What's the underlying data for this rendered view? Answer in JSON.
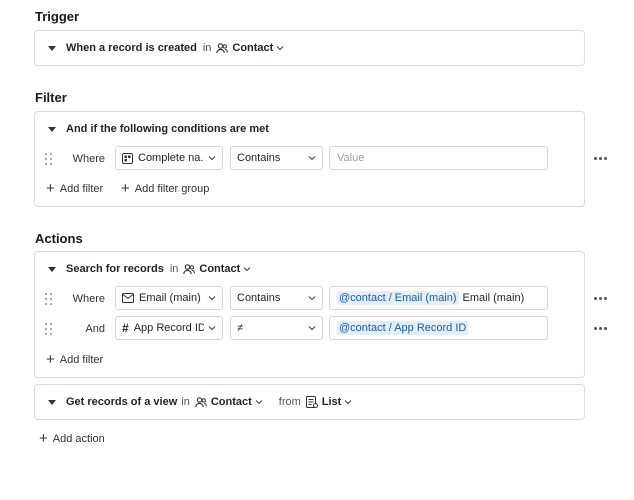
{
  "trigger": {
    "section_title": "Trigger",
    "text": "When a record is created",
    "in_label": "in",
    "entity": "Contact"
  },
  "filter": {
    "section_title": "Filter",
    "header": "And if the following conditions are met",
    "row": {
      "label": "Where",
      "field": "Complete na...",
      "operator": "Contains",
      "value_placeholder": "Value"
    },
    "add_filter": "Add filter",
    "add_filter_group": "Add filter group"
  },
  "actions": {
    "section_title": "Actions",
    "search": {
      "text": "Search for records",
      "in_label": "in",
      "entity": "Contact",
      "rows": [
        {
          "label": "Where",
          "field": "Email (main)",
          "operator": "Contains",
          "token": "@contact / Email (main)",
          "value_text": "Email (main)"
        },
        {
          "label": "And",
          "field": "App Record ID",
          "operator": "≠",
          "token": "@contact / App Record ID",
          "value_text": ""
        }
      ],
      "add_filter": "Add filter"
    },
    "get_records": {
      "text": "Get records of a view",
      "in_label": "in",
      "entity": "Contact",
      "from_label": "from",
      "view": "List"
    },
    "add_action": "Add action"
  },
  "colors": {
    "border": "#d9dce1",
    "token_bg": "#e3eef9",
    "token_text": "#1e5fa8",
    "placeholder": "#9aa0a6"
  },
  "icons": [
    "people-icon",
    "chevron-down-icon",
    "drag-handle-icon",
    "text-field-icon",
    "mail-icon",
    "hash-icon",
    "list-view-icon",
    "plus-icon",
    "more-icon",
    "collapse-caret-icon"
  ]
}
